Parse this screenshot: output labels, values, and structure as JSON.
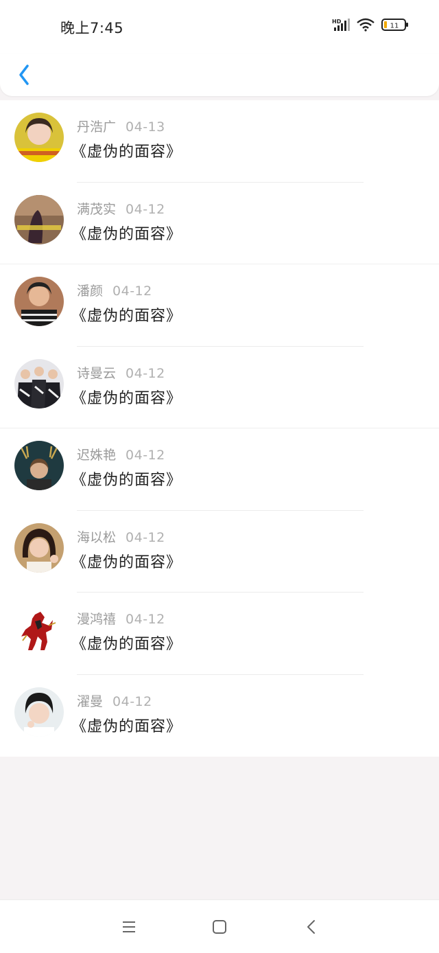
{
  "status_bar": {
    "time": "晚上7:45",
    "network": "HD",
    "battery": "11"
  },
  "header": {
    "back_icon": "back-chevron-icon",
    "accent": "#2196f3"
  },
  "items": [
    {
      "name": "丹浩广",
      "date": "04-13",
      "title": "《虚伪的面容》"
    },
    {
      "name": "满茂实",
      "date": "04-12",
      "title": "《虚伪的面容》"
    },
    {
      "name": "潘颜",
      "date": "04-12",
      "title": "《虚伪的面容》"
    },
    {
      "name": "诗曼云",
      "date": "04-12",
      "title": "《虚伪的面容》"
    },
    {
      "name": "迟姝艳",
      "date": "04-12",
      "title": "《虚伪的面容》"
    },
    {
      "name": "海以松",
      "date": "04-12",
      "title": "《虚伪的面容》"
    },
    {
      "name": "漫鸿禧",
      "date": "04-12",
      "title": "《虚伪的面容》"
    },
    {
      "name": "濯曼",
      "date": "04-12",
      "title": "《虚伪的面容》"
    }
  ],
  "nav": {
    "menu_icon": "menu-icon",
    "home_icon": "home-square-icon",
    "back_icon": "back-icon"
  }
}
